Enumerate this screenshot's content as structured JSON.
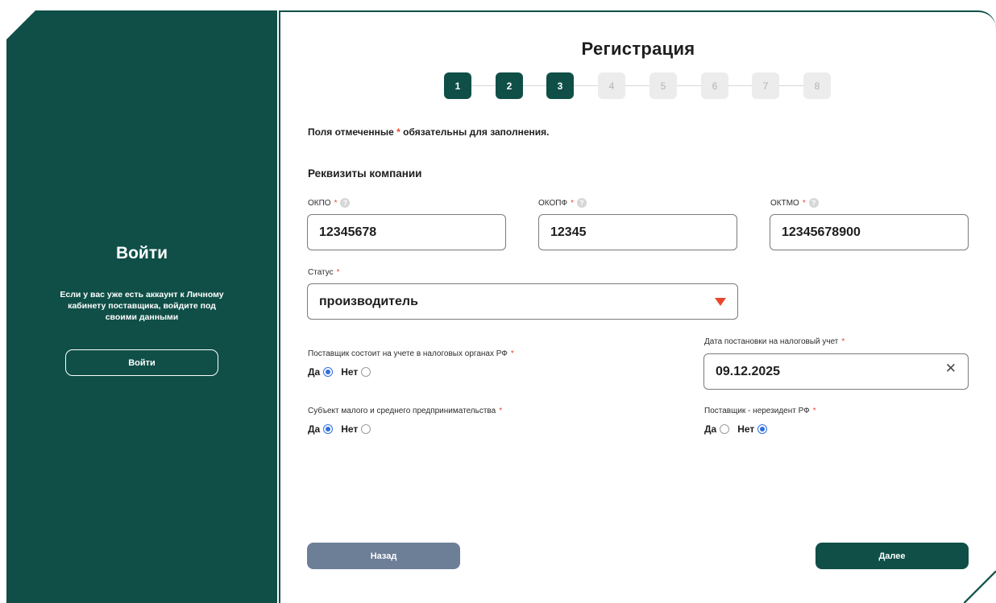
{
  "left_panel": {
    "title": "Войти",
    "description": "Если у вас уже есть аккаунт к Личному кабинету поставщика, войдите под своими данными",
    "login_button": "Войти",
    "bg_color": "#0f4f47"
  },
  "form": {
    "title": "Регистрация",
    "steps": [
      {
        "label": "1",
        "state": "active"
      },
      {
        "label": "2",
        "state": "active"
      },
      {
        "label": "3",
        "state": "active"
      },
      {
        "label": "4",
        "state": "inactive"
      },
      {
        "label": "5",
        "state": "inactive"
      },
      {
        "label": "6",
        "state": "inactive"
      },
      {
        "label": "7",
        "state": "inactive"
      },
      {
        "label": "8",
        "state": "inactive"
      }
    ],
    "required_note_before": "Поля отмеченные ",
    "required_note_star": "*",
    "required_note_after": " обязательны для заполнения.",
    "section_title": "Реквизиты компании",
    "okpo": {
      "label": "ОКПО",
      "value": "12345678"
    },
    "okopf": {
      "label": "ОКОПФ",
      "value": "12345"
    },
    "oktmo": {
      "label": "ОКТМО",
      "value": "12345678900"
    },
    "status": {
      "label": "Статус",
      "value": "производитель"
    },
    "tax_registered": {
      "label": "Поставщик состоит на учете в налоговых органах РФ",
      "yes": "Да",
      "no": "Нет",
      "selected": "yes"
    },
    "tax_date": {
      "label": "Дата постановки на налоговый учет",
      "value": "09.12.2025"
    },
    "sme": {
      "label": "Субъект малого и среднего предпринимательства",
      "yes": "Да",
      "no": "Нет",
      "selected": "yes"
    },
    "nonresident": {
      "label": "Поставщик - нерезидент РФ",
      "yes": "Да",
      "no": "Нет",
      "selected": "no"
    },
    "back_button": "Назад",
    "next_button": "Далее",
    "star": "*",
    "help": "?"
  },
  "colors": {
    "primary": "#0f4f47",
    "required": "#e8472c",
    "radio_selected": "#2f6fe0",
    "back_button": "#6d7e97"
  }
}
